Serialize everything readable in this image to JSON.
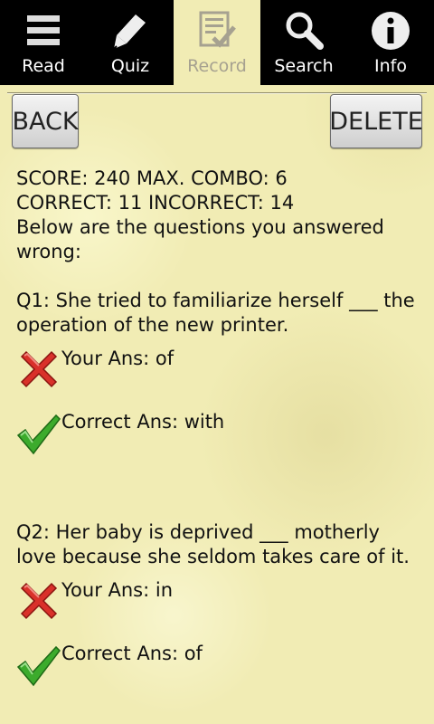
{
  "tabs": [
    {
      "label": "Read",
      "icon": "list-icon",
      "selected": false
    },
    {
      "label": "Quiz",
      "icon": "pen-icon",
      "selected": false
    },
    {
      "label": "Record",
      "icon": "checklist-icon",
      "selected": true
    },
    {
      "label": "Search",
      "icon": "search-icon",
      "selected": false
    },
    {
      "label": "Info",
      "icon": "info-icon",
      "selected": false
    }
  ],
  "toolbar": {
    "back_label": "BACK",
    "delete_label": "DELETE"
  },
  "summary": {
    "line1": "SCORE: 240 MAX. COMBO: 6",
    "line2": "CORRECT: 11 INCORRECT: 14",
    "intro": "Below are the questions you answered wrong:"
  },
  "questions": [
    {
      "text": "Q1: She tried to familiarize herself ___ the operation of the new printer.",
      "your_answer": "Your Ans: of",
      "correct_answer": "Correct Ans: with"
    },
    {
      "text": "Q2: Her baby is deprived ___ motherly love because she seldom takes care of it.",
      "your_answer": "Your Ans: in",
      "correct_answer": "Correct Ans: of"
    }
  ],
  "colors": {
    "background": "#f1ecb4",
    "tabbar": "#000000",
    "wrong_mark": "#d9312a",
    "right_mark": "#3cab2c"
  }
}
